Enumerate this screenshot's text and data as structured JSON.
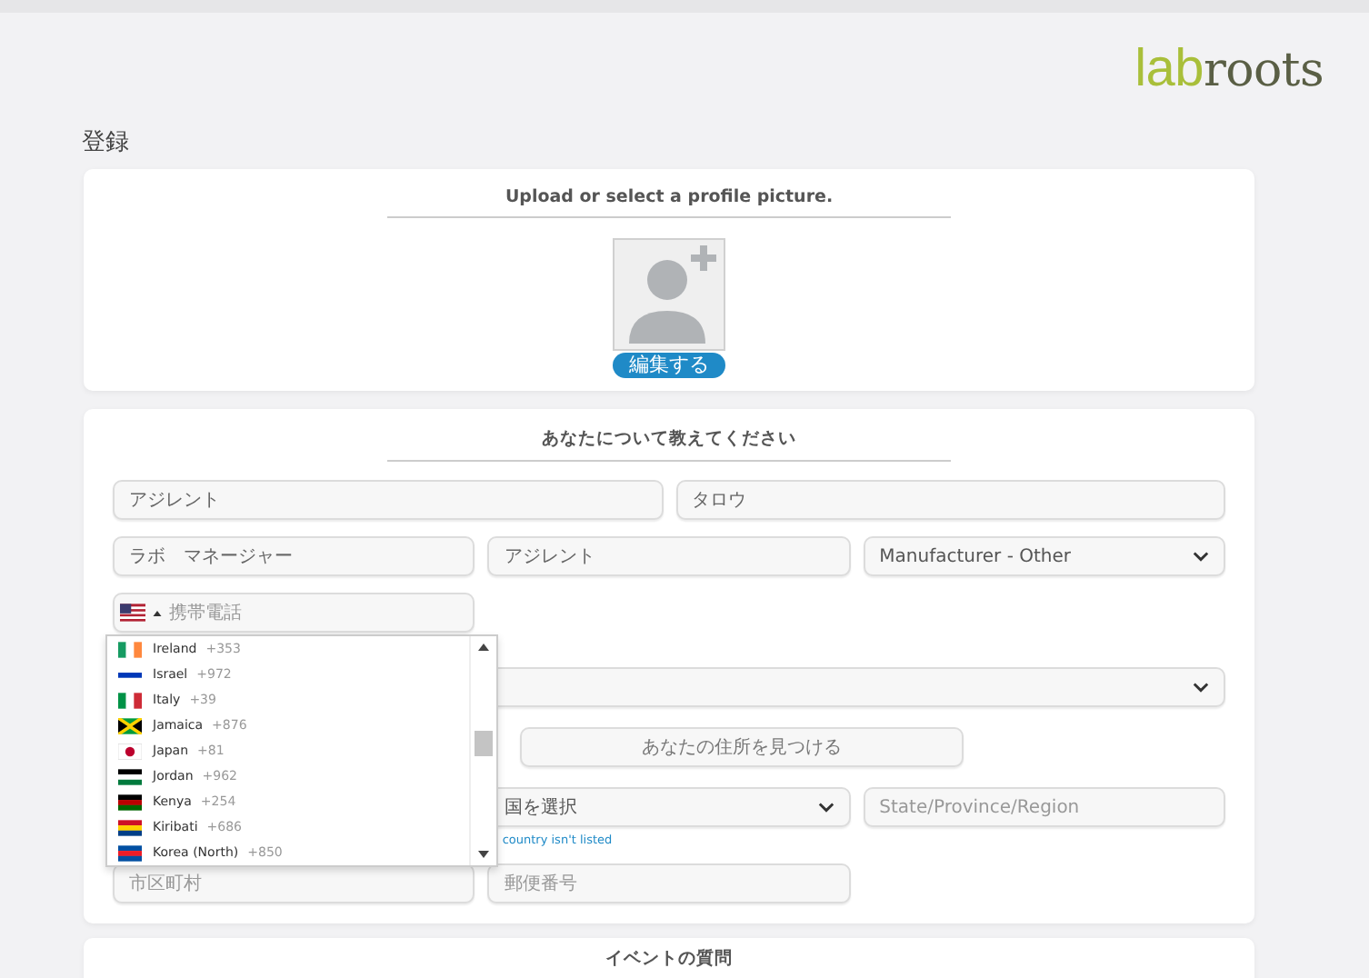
{
  "logo": {
    "part_1": "lab",
    "part_2": "roots"
  },
  "page_title": "登録",
  "profile_card": {
    "heading": "Upload or select a profile picture.",
    "edit_button": "編集する"
  },
  "about_card": {
    "heading": "あなたについて教えてください",
    "first_name": {
      "value": "アジレント"
    },
    "last_name": {
      "value": "タロウ"
    },
    "job_title": {
      "value": "ラボ　マネージャー"
    },
    "company": {
      "value": "アジレント"
    },
    "industry": {
      "value": "Manufacturer - Other"
    },
    "phone": {
      "placeholder": "携帯電話",
      "country_list": [
        {
          "name": "Ireland",
          "code": "+353"
        },
        {
          "name": "Israel",
          "code": "+972"
        },
        {
          "name": "Italy",
          "code": "+39"
        },
        {
          "name": "Jamaica",
          "code": "+876"
        },
        {
          "name": "Japan",
          "code": "+81"
        },
        {
          "name": "Jordan",
          "code": "+962"
        },
        {
          "name": "Kenya",
          "code": "+254"
        },
        {
          "name": "Kiribati",
          "code": "+686"
        },
        {
          "name": "Korea (North)",
          "code": "+850"
        }
      ]
    },
    "find_address_button": "あなたの住所を見つける",
    "country": {
      "value": "国を選択"
    },
    "state": {
      "placeholder": "State/Province/Region"
    },
    "country_not_listed_link": "country isn't listed",
    "city": {
      "placeholder": "市区町村"
    },
    "postal_code": {
      "placeholder": "郵便番号"
    }
  },
  "event_card": {
    "heading": "イベントの質問"
  }
}
